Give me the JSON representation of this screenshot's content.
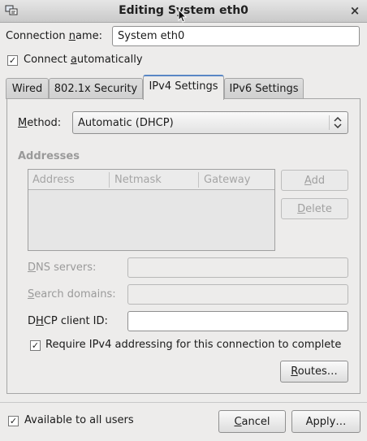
{
  "window": {
    "title": "Editing System eth0",
    "close_glyph": "×"
  },
  "connection": {
    "name_label_pre": "Connection ",
    "name_label_u": "n",
    "name_label_post": "ame:",
    "name_value": "System eth0",
    "auto_label_pre": "Connect ",
    "auto_label_u": "a",
    "auto_label_post": "utomatically",
    "auto_checked": true
  },
  "tabs": [
    {
      "label": "Wired",
      "active": false
    },
    {
      "label": "802.1x Security",
      "active": false
    },
    {
      "label": "IPv4 Settings",
      "active": true
    },
    {
      "label": "IPv6 Settings",
      "active": false
    }
  ],
  "ipv4": {
    "method_label_u": "M",
    "method_label_post": "ethod:",
    "method_value": "Automatic (DHCP)",
    "addresses_heading": "Addresses",
    "columns": [
      "Address",
      "Netmask",
      "Gateway"
    ],
    "add_label_u": "A",
    "add_label_post": "dd",
    "delete_label_u": "D",
    "delete_label_post": "elete",
    "dns_label_u": "D",
    "dns_label_post": "NS servers:",
    "search_label_u": "S",
    "search_label_post": "earch domains:",
    "dhcp_label_pre": "D",
    "dhcp_label_u": "H",
    "dhcp_label_post": "CP client ID:",
    "dhcp_value": "",
    "require_label": "Require IPv4 addressing for this connection to complete",
    "require_checked": true,
    "routes_label_u": "R",
    "routes_label_post": "outes…"
  },
  "footer": {
    "all_users_label": "Available to all users",
    "all_users_checked": true,
    "cancel_label_u": "C",
    "cancel_label_post": "ancel",
    "apply_label": "Apply…"
  },
  "check_glyph": "✓"
}
